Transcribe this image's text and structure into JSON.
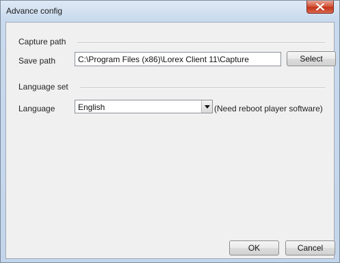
{
  "window": {
    "title": "Advance config",
    "close_icon": "close-x-icon"
  },
  "capture_path": {
    "group_title": "Capture path",
    "save_path_label": "Save path",
    "save_path_value": "C:\\Program Files (x86)\\Lorex Client 11\\Capture",
    "select_button": "Select"
  },
  "language_set": {
    "group_title": "Language set",
    "language_label": "Language",
    "language_value": "English",
    "dropdown_icon": "chevron-down-icon",
    "note": "(Need reboot player software)"
  },
  "footer": {
    "ok_button": "OK",
    "cancel_button": "Cancel"
  }
}
